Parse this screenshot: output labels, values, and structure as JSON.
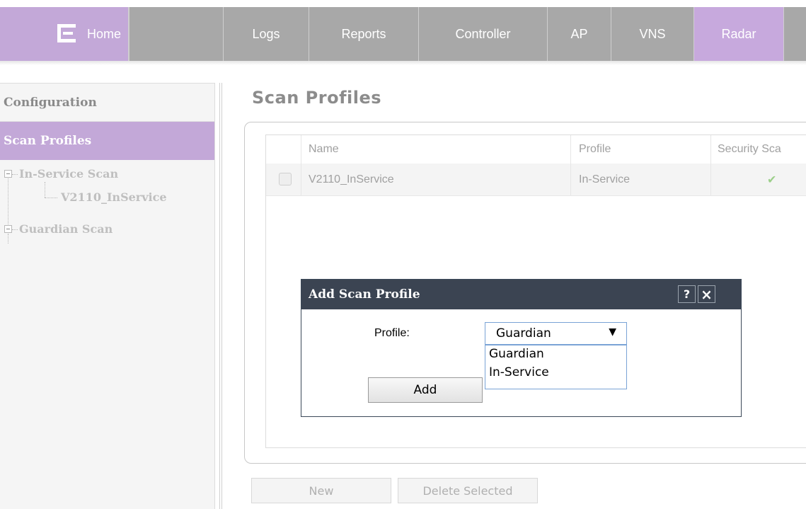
{
  "nav": {
    "tabs": [
      {
        "label": "Home"
      },
      {
        "label": "Logs"
      },
      {
        "label": "Reports"
      },
      {
        "label": "Controller"
      },
      {
        "label": "AP"
      },
      {
        "label": "VNS"
      },
      {
        "label": "Radar"
      }
    ],
    "active_tab": "Radar",
    "colors": {
      "bar": "#a8a8a8",
      "active": "#c7a9dd"
    }
  },
  "sidebar": {
    "heading": "Configuration",
    "selected": "Scan Profiles",
    "tree": [
      {
        "label": "In-Service Scan",
        "children": [
          "V2110_InService"
        ]
      },
      {
        "label": "Guardian Scan",
        "children": []
      }
    ]
  },
  "main": {
    "title": "Scan Profiles",
    "table": {
      "columns": [
        "Name",
        "Profile",
        "Security Sca"
      ],
      "rows": [
        {
          "name": "V2110_InService",
          "profile": "In-Service",
          "security": "✔"
        }
      ]
    },
    "buttons": {
      "new": "New",
      "delete": "Delete Selected"
    }
  },
  "dialog": {
    "title": "Add Scan Profile",
    "help_icon": "?",
    "close_icon": "×",
    "profile_label": "Profile:",
    "profile_selected": "Guardian",
    "profile_options": [
      "Guardian",
      "In-Service"
    ],
    "add_button": "Add"
  }
}
